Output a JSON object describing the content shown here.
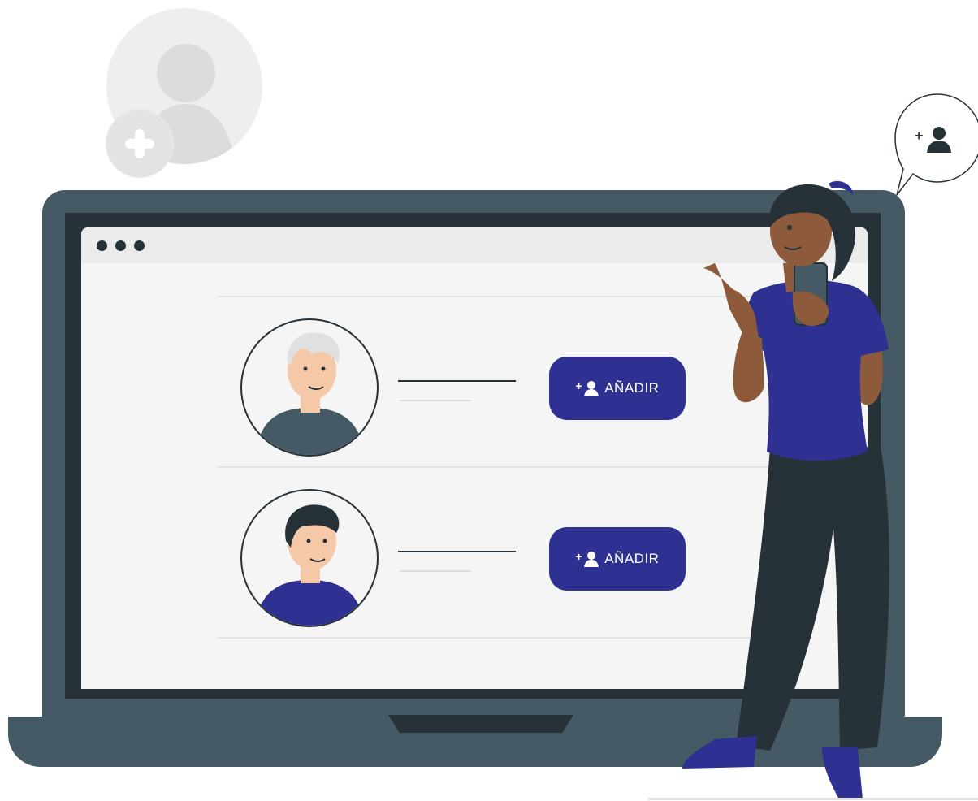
{
  "speech_bubble": {
    "icon": "add-user-icon",
    "plus": "+"
  },
  "browser": {
    "window_dots": [
      "dot",
      "dot",
      "dot"
    ]
  },
  "contacts": [
    {
      "avatar": "older-man-avatar",
      "hair_color": "#e0e0e0",
      "shirt_color": "#455a64",
      "add_label": "AÑADIR",
      "add_plus": "+"
    },
    {
      "avatar": "young-man-avatar",
      "hair_color": "#263238",
      "shirt_color": "#2e3192",
      "add_label": "AÑADIR",
      "add_plus": "+"
    }
  ],
  "colors": {
    "accent": "#2e3192",
    "laptop": "#455a64",
    "dark": "#263238",
    "screen": "#f5f5f5",
    "skin_woman": "#8d5a3b",
    "skin_man": "#f5c8a8"
  }
}
